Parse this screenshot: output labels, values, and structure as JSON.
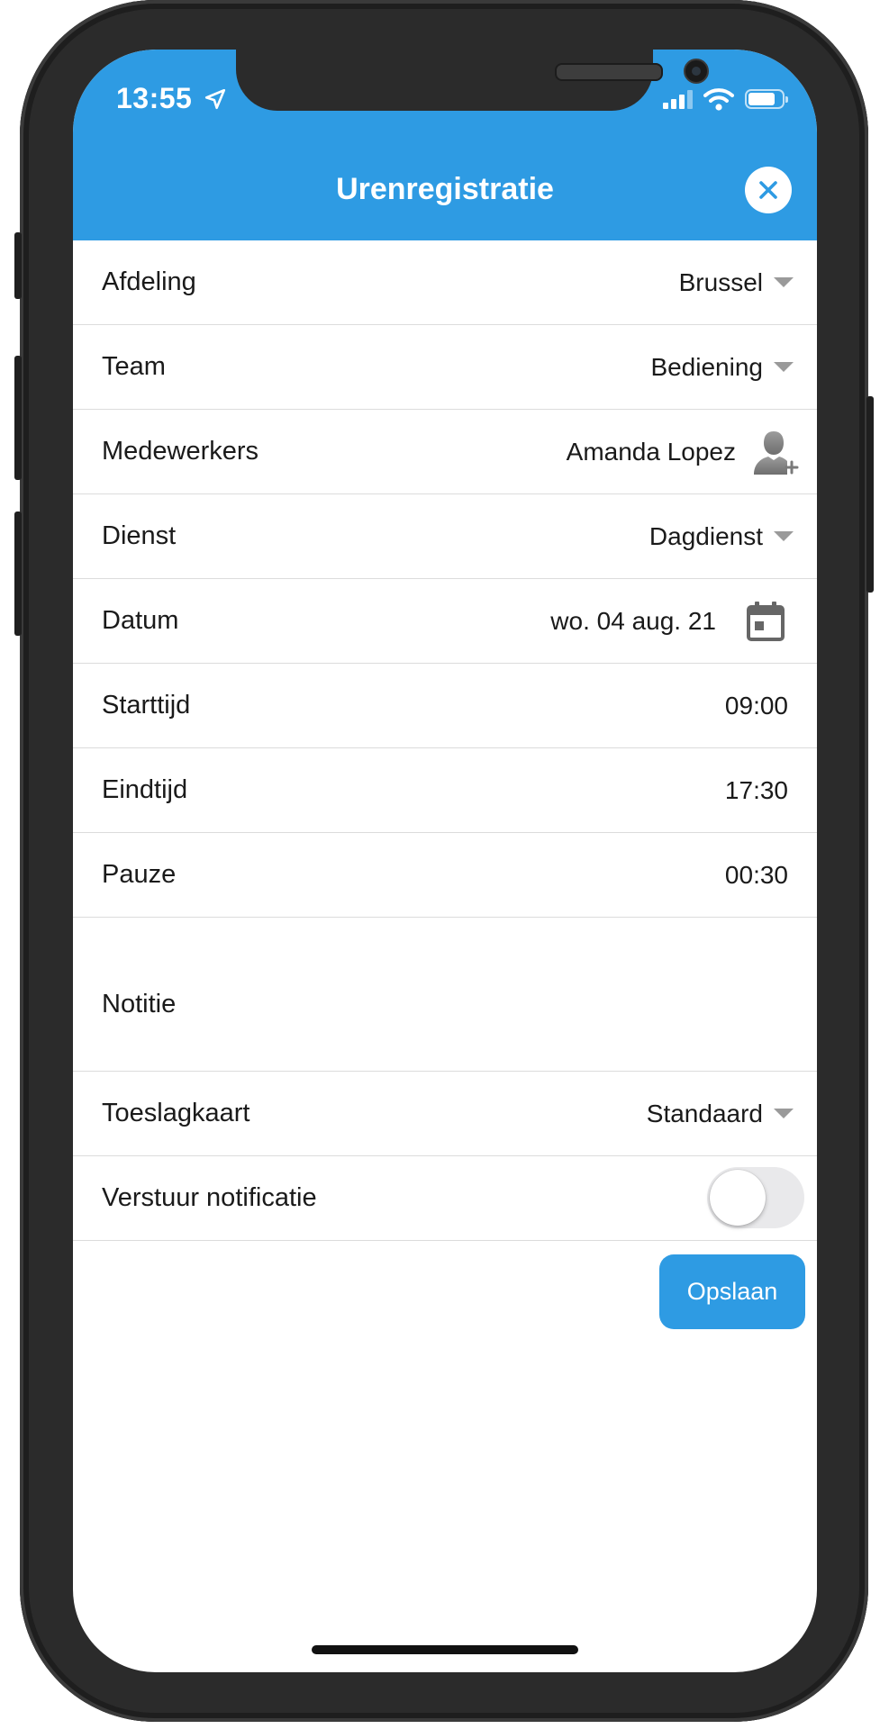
{
  "status_bar": {
    "time": "13:55",
    "battery_level": 0.8
  },
  "header": {
    "title": "Urenregistratie",
    "close_icon": "close-icon"
  },
  "form": {
    "afdeling": {
      "label": "Afdeling",
      "value": "Brussel"
    },
    "team": {
      "label": "Team",
      "value": "Bediening"
    },
    "medewerkers": {
      "label": "Medewerkers",
      "value": "Amanda Lopez",
      "icon": "user-add-icon"
    },
    "dienst": {
      "label": "Dienst",
      "value": "Dagdienst"
    },
    "datum": {
      "label": "Datum",
      "value": "wo. 04 aug. 21",
      "icon": "calendar-icon"
    },
    "starttijd": {
      "label": "Starttijd",
      "value": "09:00"
    },
    "eindtijd": {
      "label": "Eindtijd",
      "value": "17:30"
    },
    "pauze": {
      "label": "Pauze",
      "value": "00:30"
    },
    "notitie": {
      "label": "Notitie",
      "value": ""
    },
    "toeslagkaart": {
      "label": "Toeslagkaart",
      "value": "Standaard"
    },
    "notificatie": {
      "label": "Verstuur notificatie",
      "on": false
    }
  },
  "actions": {
    "save_label": "Opslaan"
  },
  "colors": {
    "brand": "#2e9be3",
    "text": "#1a1a1a",
    "divider": "#dcdcdc",
    "caret": "#9a9a9a"
  }
}
